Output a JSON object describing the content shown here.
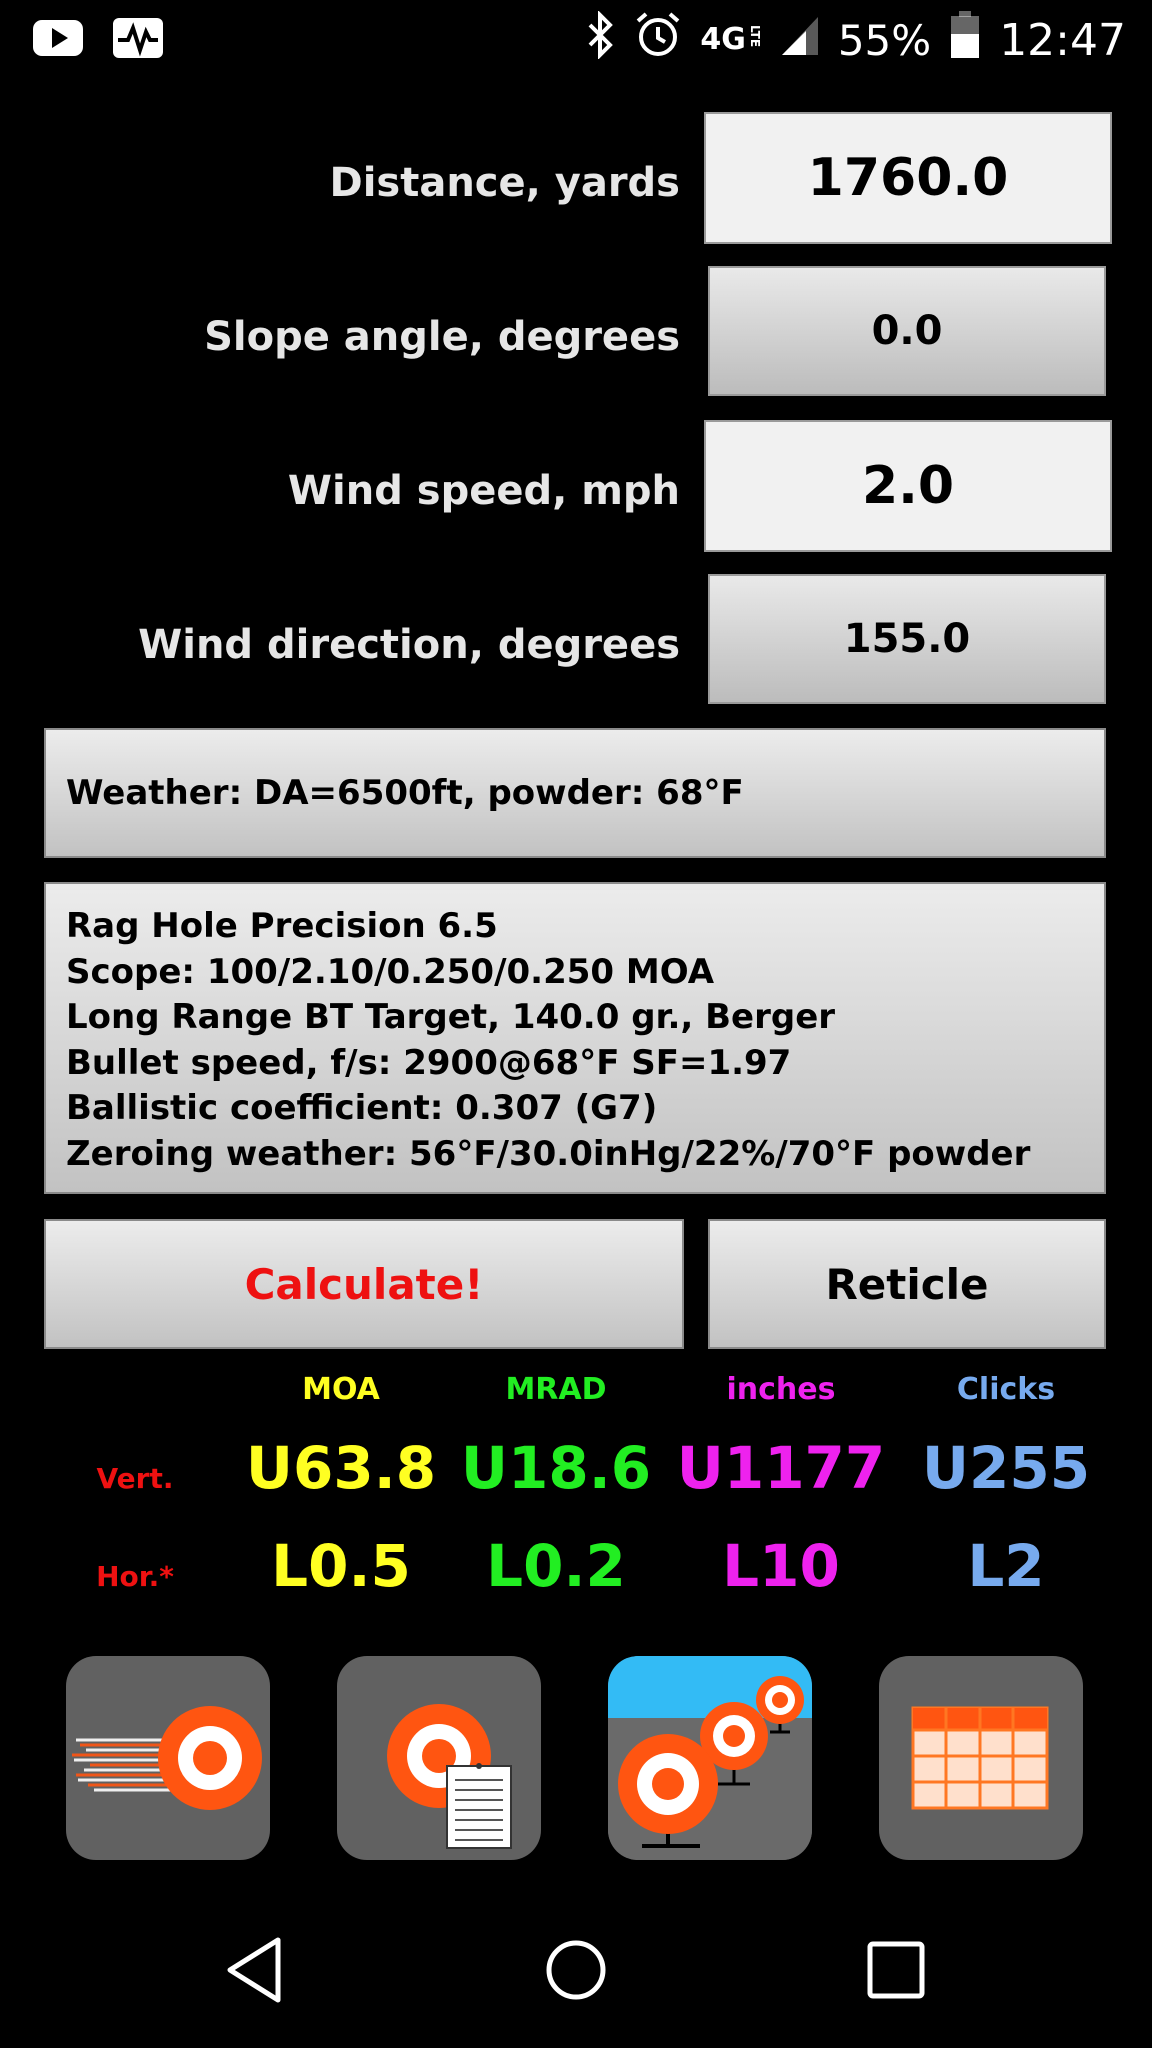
{
  "status_bar": {
    "network": "4G",
    "network_sub": "LTE",
    "battery": "55%",
    "time": "12:47"
  },
  "inputs": [
    {
      "label": "Distance, yards",
      "value": "1760.0"
    },
    {
      "label": "Slope angle, degrees",
      "value": "0.0"
    },
    {
      "label": "Wind speed, mph",
      "value": "2.0"
    },
    {
      "label": "Wind direction, degrees",
      "value": "155.0"
    }
  ],
  "weather": "Weather: DA=6500ft, powder: 68°F",
  "profile": [
    "Rag Hole Precision 6.5",
    "Scope: 100/2.10/0.250/0.250 MOA",
    "Long Range BT Target, 140.0 gr., Berger",
    "Bullet speed, f/s: 2900@68°F SF=1.97",
    "Ballistic coefficient: 0.307 (G7)",
    "Zeroing weather: 56°F/30.0inHg/22%/70°F powder"
  ],
  "buttons": {
    "calculate": "Calculate!",
    "reticle": "Reticle"
  },
  "results": {
    "columns": [
      "MOA",
      "MRAD",
      "inches",
      "Clicks"
    ],
    "rows": [
      {
        "label": "Vert.",
        "values": [
          "U63.8",
          "U18.6",
          "U1177",
          "U255"
        ]
      },
      {
        "label": "Hor.*",
        "values": [
          "L0.5",
          "L0.2",
          "L10",
          "L2"
        ]
      }
    ]
  },
  "colors": {
    "moa": "#ffff22",
    "mrad": "#22ee22",
    "inches": "#ee22ee",
    "clicks": "#77aaee",
    "accent": "#ee1111",
    "target_orange": "#ff5511"
  },
  "tiles": [
    "trajectory-icon",
    "target-notes-icon",
    "range-targets-icon",
    "table-icon"
  ]
}
